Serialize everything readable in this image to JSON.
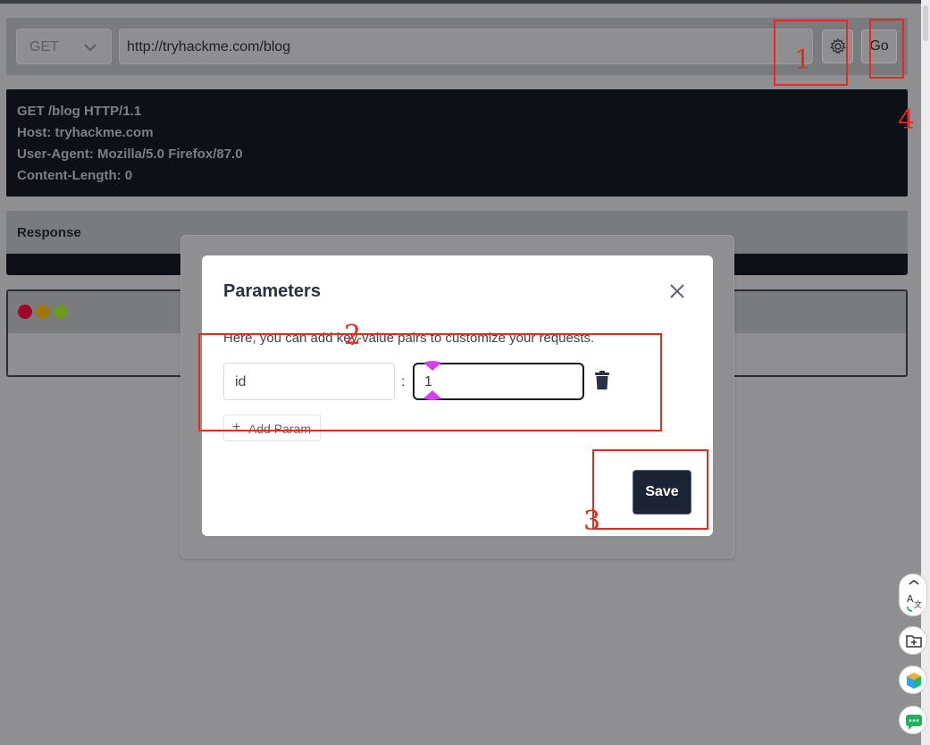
{
  "request_bar": {
    "method": "GET",
    "url": "http://tryhackme.com/blog",
    "go_label": "Go"
  },
  "request_text": [
    "GET /blog HTTP/1.1",
    "Host: tryhackme.com",
    "User-Agent: Mozilla/5.0 Firefox/87.0",
    "Content-Length: 0"
  ],
  "response": {
    "title": "Response"
  },
  "browser": {
    "dot_colors": [
      "#a2072a",
      "#a0780a",
      "#6b9a1c"
    ]
  },
  "modal": {
    "title": "Parameters",
    "description": "Here, you can add key-value pairs to customize your requests.",
    "param_key": "id",
    "param_value": "1",
    "separator": ":",
    "add_param_label": "Add Param",
    "save_label": "Save"
  },
  "annotations": [
    "1",
    "2",
    "3",
    "4"
  ],
  "colors": {
    "annotation": "#e8291f",
    "save_bg": "#1b2335",
    "overlay": "#8f8f91"
  },
  "side_tools": [
    "translate-icon",
    "screenshot-icon",
    "cube-icon",
    "chat-icon"
  ]
}
